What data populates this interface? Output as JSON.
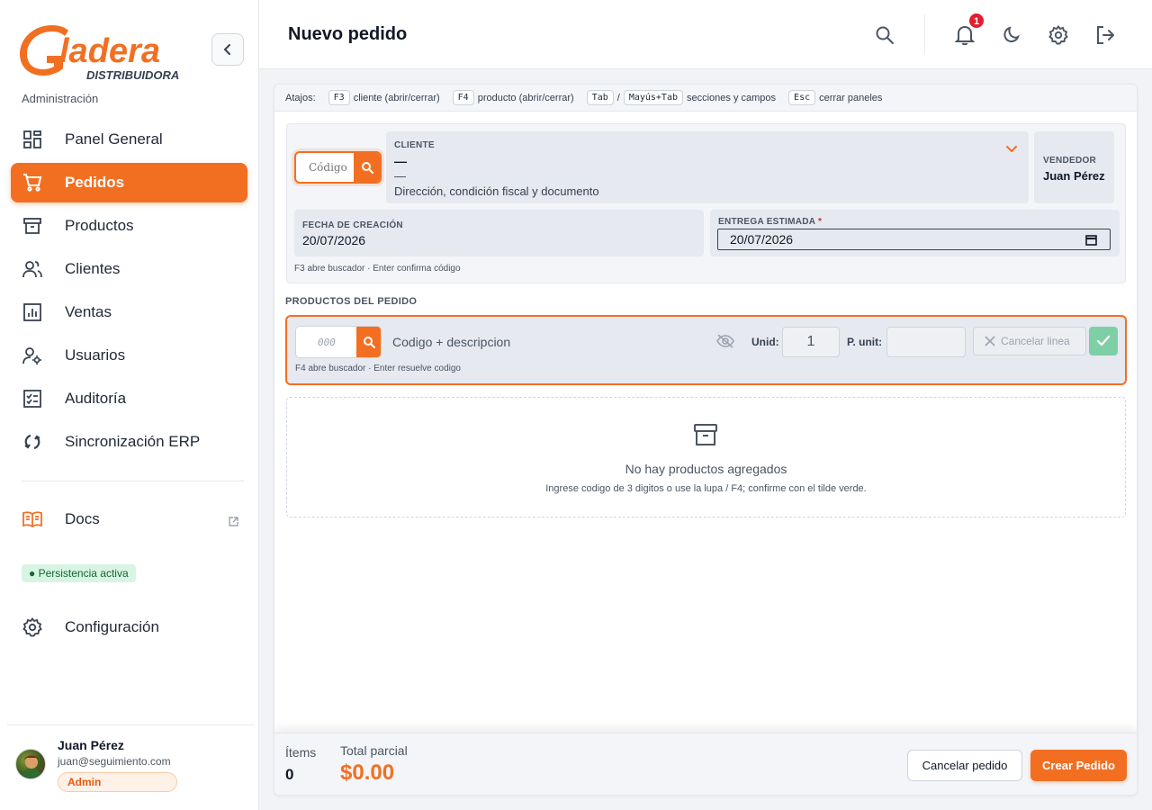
{
  "brand": {
    "name": "Gladera",
    "sub": "DISTRIBUIDORA",
    "accent": "#f26f22"
  },
  "sidebar": {
    "section_label": "Administración",
    "items": [
      {
        "label": "Panel General",
        "icon": "dashboard-icon",
        "active": false
      },
      {
        "label": "Pedidos",
        "icon": "cart-icon",
        "active": true
      },
      {
        "label": "Productos",
        "icon": "archive-icon",
        "active": false
      },
      {
        "label": "Clientes",
        "icon": "users-icon",
        "active": false
      },
      {
        "label": "Ventas",
        "icon": "chart-icon",
        "active": false
      },
      {
        "label": "Usuarios",
        "icon": "user-gear-icon",
        "active": false
      },
      {
        "label": "Auditoría",
        "icon": "checklist-icon",
        "active": false
      },
      {
        "label": "Sincronización ERP",
        "icon": "sync-icon",
        "active": false
      }
    ],
    "docs_label": "Docs",
    "persistence": "● Persistencia activa",
    "config_label": "Configuración",
    "user": {
      "name": "Juan Pérez",
      "email": "juan@seguimiento.com",
      "role": "Admin"
    }
  },
  "header": {
    "title": "Nuevo pedido",
    "notifications": "1"
  },
  "shortcuts": {
    "label": "Atajos:",
    "items": [
      {
        "keys": [
          "F3"
        ],
        "text": "cliente (abrir/cerrar)"
      },
      {
        "keys": [
          "F4"
        ],
        "text": "producto (abrir/cerrar)"
      },
      {
        "keys": [
          "Tab",
          "Mayús+Tab"
        ],
        "sep": "/",
        "text": "secciones y campos"
      },
      {
        "keys": [
          "Esc"
        ],
        "text": "cerrar paneles"
      }
    ]
  },
  "client": {
    "code_placeholder": "Código",
    "cliente_label": "CLIENTE",
    "name": "—",
    "secondary": "—",
    "address_placeholder": "Dirección, condición fiscal y documento",
    "vendedor_label": "VENDEDOR",
    "vendedor": "Juan Pérez",
    "fecha_label": "FECHA DE CREACIÓN",
    "fecha": "20/07/2026",
    "entrega_label": "ENTREGA ESTIMADA",
    "entrega_required": "*",
    "entrega": "20/07/2026",
    "hint": "F3 abre buscador · Enter confirma código"
  },
  "products": {
    "title": "PRODUCTOS DEL PEDIDO",
    "code_placeholder": "000",
    "desc_placeholder": "Codigo + descripcion",
    "unid_label": "Unid:",
    "unid_value": "1",
    "punit_label": "P. unit:",
    "punit_value": "",
    "cancel_line": "Cancelar linea",
    "hint": "F4 abre buscador · Enter resuelve codigo",
    "empty_title": "No hay productos agregados",
    "empty_sub": "Ingrese codigo de 3 digitos o use la lupa / F4; confirme con el tilde verde."
  },
  "footer": {
    "items_label": "Ítems",
    "items_value": "0",
    "total_label": "Total parcial",
    "total_value": "$0.00",
    "cancel_button": "Cancelar pedido",
    "create_button": "Crear Pedido"
  }
}
